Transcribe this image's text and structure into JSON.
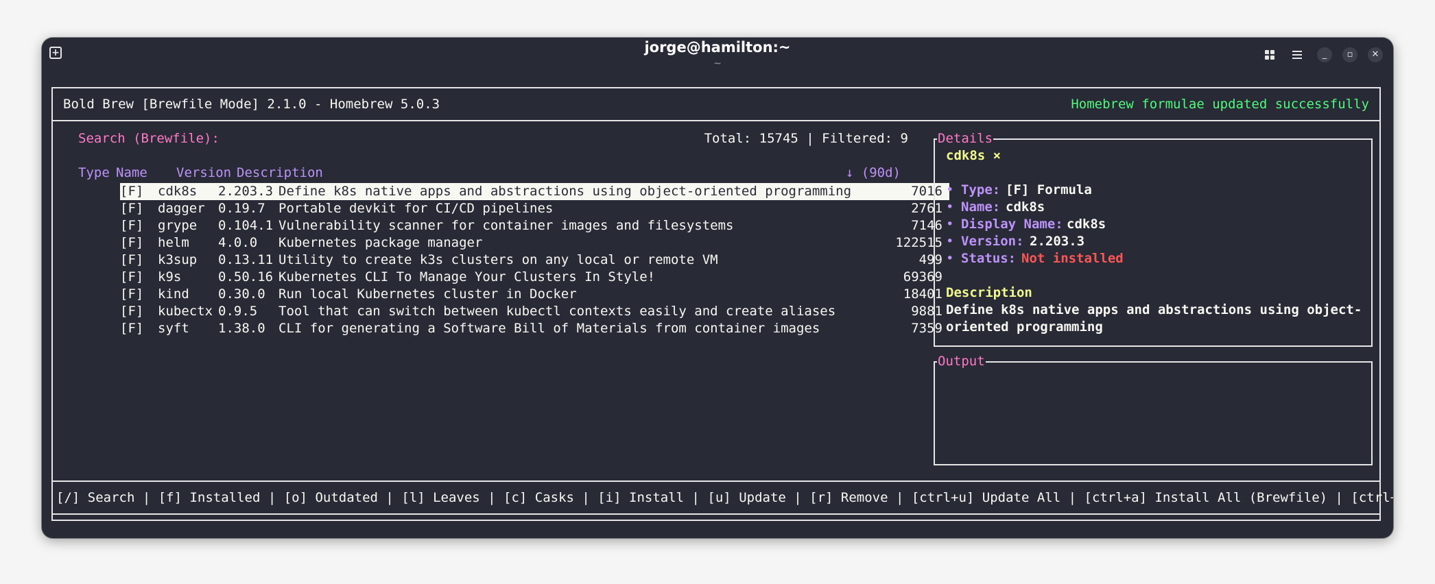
{
  "window": {
    "title": "jorge@hamilton:~",
    "subtitle": "~"
  },
  "header": {
    "app_title": "Bold Brew [Brewfile Mode] 2.1.0 - Homebrew 5.0.3",
    "status_message": "Homebrew formulae updated successfully"
  },
  "search": {
    "label": "Search (Brewfile):",
    "counts": "Total: 15745 | Filtered: 9"
  },
  "table": {
    "columns": [
      "Type",
      "Name",
      "Version",
      "Description",
      "↓ (90d)"
    ],
    "rows": [
      {
        "type": "[F]",
        "name": "cdk8s",
        "version": "2.203.3",
        "description": "Define k8s native apps and abstractions using object-oriented programming",
        "downloads": "7016"
      },
      {
        "type": "[F]",
        "name": "dagger",
        "version": "0.19.7",
        "description": "Portable devkit for CI/CD pipelines",
        "downloads": "2761"
      },
      {
        "type": "[F]",
        "name": "grype",
        "version": "0.104.1",
        "description": "Vulnerability scanner for container images and filesystems",
        "downloads": "7146"
      },
      {
        "type": "[F]",
        "name": "helm",
        "version": "4.0.0",
        "description": "Kubernetes package manager",
        "downloads": "122515"
      },
      {
        "type": "[F]",
        "name": "k3sup",
        "version": "0.13.11",
        "description": "Utility to create k3s clusters on any local or remote VM",
        "downloads": "499"
      },
      {
        "type": "[F]",
        "name": "k9s",
        "version": "0.50.16",
        "description": "Kubernetes CLI To Manage Your Clusters In Style!",
        "downloads": "69369"
      },
      {
        "type": "[F]",
        "name": "kind",
        "version": "0.30.0",
        "description": "Run local Kubernetes cluster in Docker",
        "downloads": "18401"
      },
      {
        "type": "[F]",
        "name": "kubectx",
        "version": "0.9.5",
        "description": "Tool that can switch between kubectl contexts easily and create aliases",
        "downloads": "9881"
      },
      {
        "type": "[F]",
        "name": "syft",
        "version": "1.38.0",
        "description": "CLI for generating a Software Bill of Materials from container images",
        "downloads": "7359"
      }
    ]
  },
  "details": {
    "legend": "Details",
    "package_title": "cdk8s ×",
    "bullet": "•",
    "type_label": "Type:",
    "type_value": "[F] Formula",
    "name_label": "Name:",
    "name_value": "cdk8s",
    "display_label": "Display Name:",
    "display_value": "cdk8s",
    "version_label": "Version:",
    "version_value": "2.203.3",
    "status_label": "Status:",
    "status_value": "Not installed",
    "desc_heading": "Description",
    "desc_line1": "Define k8s native apps and abstractions using object-",
    "desc_line2": "oriented programming"
  },
  "output": {
    "legend": "Output"
  },
  "footer": {
    "shortcuts": "[/] Search | [f] Installed | [o] Outdated | [l] Leaves | [c] Casks | [i] Install | [u] Update | [r] Remove | [ctrl+u] Update All | [ctrl+a] Install All (Brewfile) | [ctrl+r]"
  }
}
